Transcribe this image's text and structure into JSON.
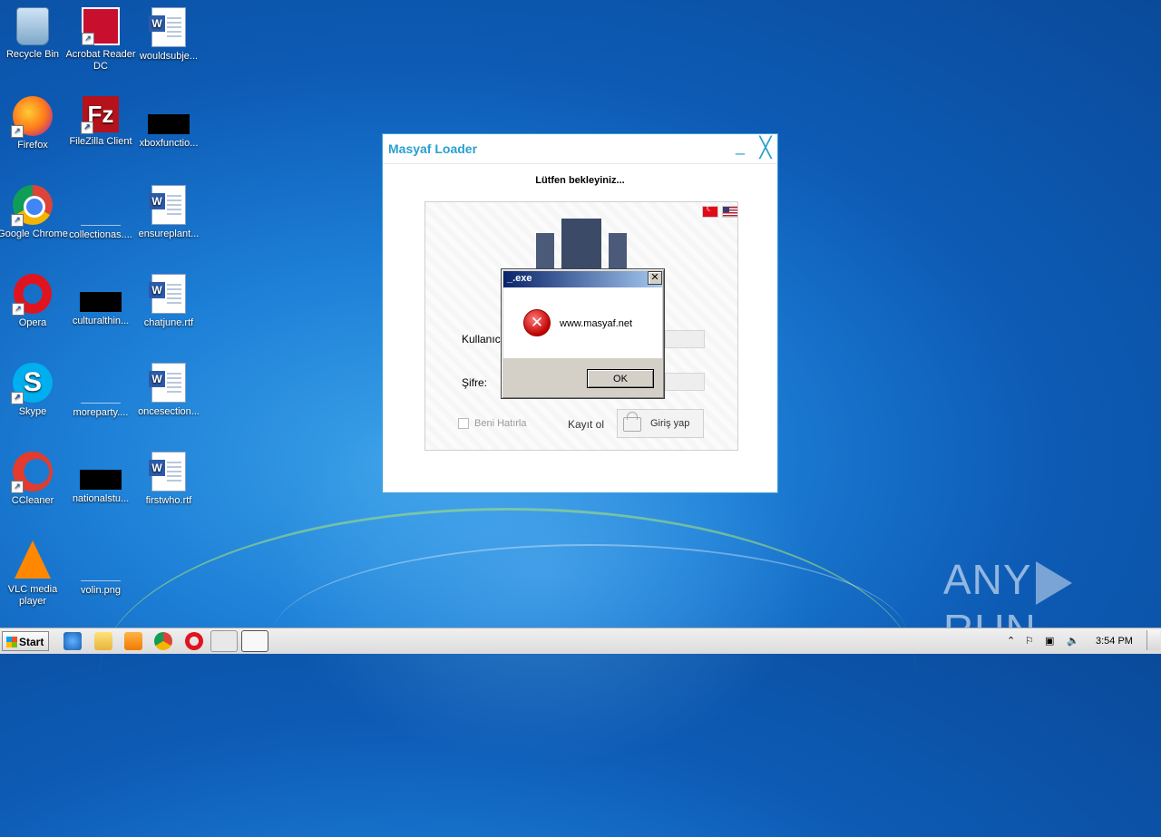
{
  "desktop": {
    "icons": [
      {
        "label": "Recycle Bin"
      },
      {
        "label": "Acrobat Reader DC"
      },
      {
        "label": "wouldsubje..."
      },
      {
        "label": "Firefox"
      },
      {
        "label": "FileZilla Client"
      },
      {
        "label": "xboxfunctio..."
      },
      {
        "label": "Google Chrome"
      },
      {
        "label": "collectionas...."
      },
      {
        "label": "ensureplant..."
      },
      {
        "label": "Opera"
      },
      {
        "label": "culturalthin..."
      },
      {
        "label": "chatjune.rtf"
      },
      {
        "label": "Skype"
      },
      {
        "label": "moreparty...."
      },
      {
        "label": "oncesection..."
      },
      {
        "label": "CCleaner"
      },
      {
        "label": "nationalstu..."
      },
      {
        "label": "firstwho.rtf"
      },
      {
        "label": "VLC media player"
      },
      {
        "label": "volin.png"
      }
    ]
  },
  "loader": {
    "title": "Masyaf Loader",
    "minimize": "_",
    "close": "╳",
    "waiting": "Lütfen bekleyiniz...",
    "username_label": "Kullanıc",
    "password_label": "Şifre:",
    "remember_label": "Beni Hatırla",
    "register_label": "Kayıt ol",
    "login_label": "Giriş yap"
  },
  "dialog": {
    "title": "_.exe",
    "close": "✕",
    "message": "www.masyaf.net",
    "ok_label": "OK"
  },
  "watermark": {
    "left": "ANY",
    "right": "RUN"
  },
  "taskbar": {
    "start_label": "Start",
    "tray_chevron": "⌃",
    "clock": "3:54 PM"
  }
}
